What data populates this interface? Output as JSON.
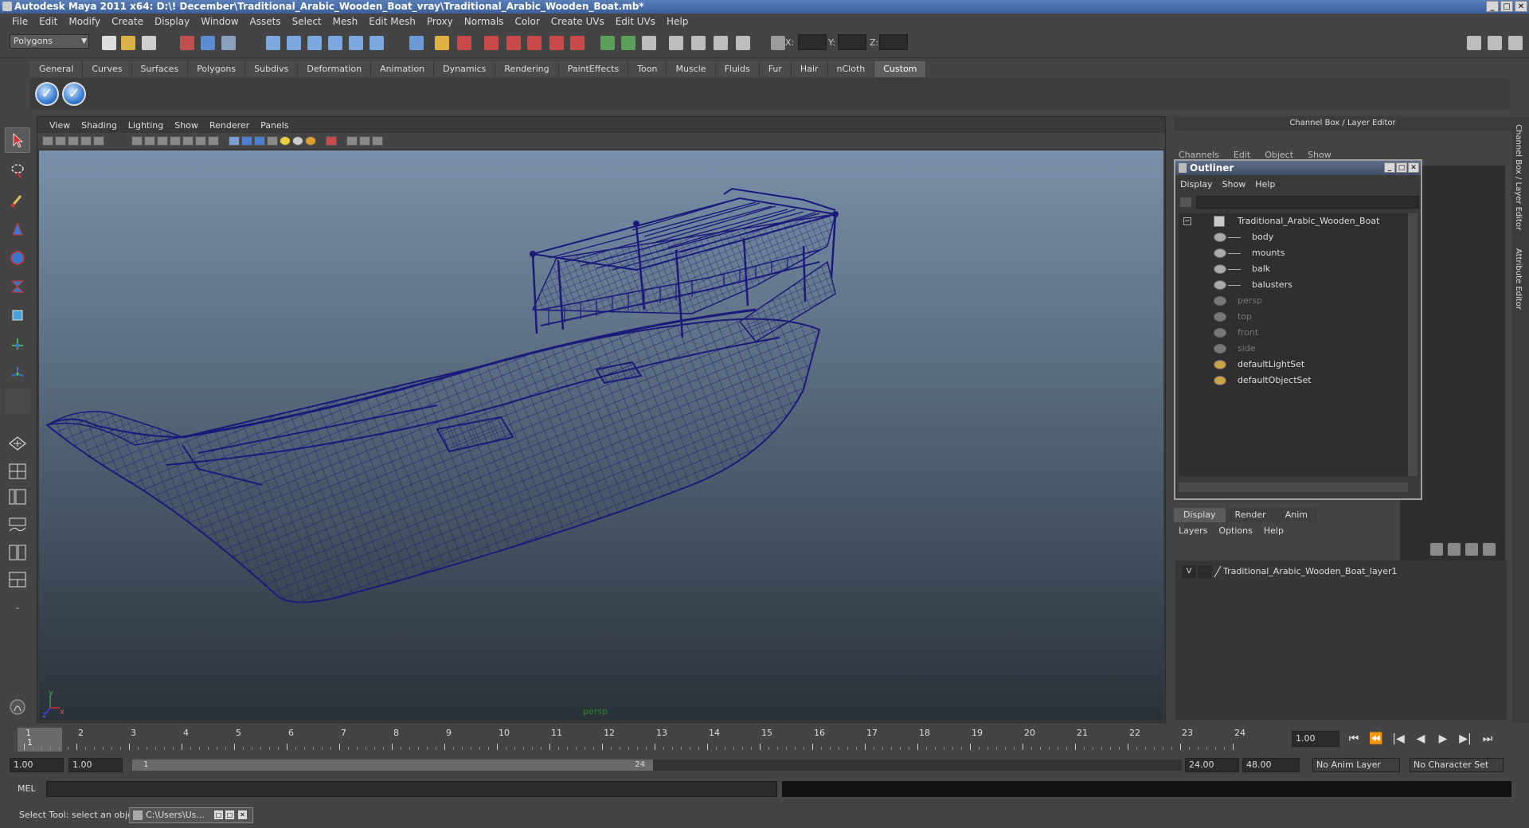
{
  "window": {
    "title": "Autodesk Maya 2011 x64: D:\\! December\\Traditional_Arabic_Wooden_Boat_vray\\Traditional_Arabic_Wooden_Boat.mb*",
    "minimize": "_",
    "maximize": "□",
    "close": "✕"
  },
  "menubar": [
    "File",
    "Edit",
    "Modify",
    "Create",
    "Display",
    "Window",
    "Assets",
    "Select",
    "Mesh",
    "Edit Mesh",
    "Proxy",
    "Normals",
    "Color",
    "Create UVs",
    "Edit UVs",
    "Help"
  ],
  "statusline": {
    "mode": "Polygons",
    "x_label": "X:",
    "y_label": "Y:",
    "z_label": "Z:"
  },
  "shelf": {
    "tabs": [
      "General",
      "Curves",
      "Surfaces",
      "Polygons",
      "Subdivs",
      "Deformation",
      "Animation",
      "Dynamics",
      "Rendering",
      "PaintEffects",
      "Toon",
      "Muscle",
      "Fluids",
      "Fur",
      "Hair",
      "nCloth",
      "Custom"
    ],
    "active_tab": "Custom",
    "buttons": [
      "check-icon",
      "check-icon"
    ],
    "button_glyph": "✓"
  },
  "viewport": {
    "menu": [
      "View",
      "Shading",
      "Lighting",
      "Show",
      "Renderer",
      "Panels"
    ],
    "camera": "persp",
    "axis_y": "y",
    "axis_x": "x",
    "axis_z": "z",
    "wire_color": "#1a1a7a"
  },
  "channel_box": {
    "header": "Channel Box / Layer Editor",
    "menu": [
      "Channels",
      "Edit",
      "Object",
      "Show"
    ]
  },
  "outliner": {
    "title": "Outliner",
    "menu": [
      "Display",
      "Show",
      "Help"
    ],
    "root": "Traditional_Arabic_Wooden_Boat",
    "children": [
      "body",
      "mounts",
      "balk",
      "balusters"
    ],
    "cameras": [
      "persp",
      "top",
      "front",
      "side"
    ],
    "sets": [
      "defaultLightSet",
      "defaultObjectSet"
    ]
  },
  "layer_editor": {
    "tabs": [
      "Display",
      "Render",
      "Anim"
    ],
    "active_tab": "Display",
    "menu": [
      "Layers",
      "Options",
      "Help"
    ],
    "layer": {
      "visible": "V",
      "name": "Traditional_Arabic_Wooden_Boat_layer1"
    }
  },
  "side_tabs": [
    "Channel Box / Layer Editor",
    "Attribute Editor"
  ],
  "timeslider": {
    "ticks": [
      "1",
      "2",
      "3",
      "4",
      "5",
      "6",
      "7",
      "8",
      "9",
      "10",
      "11",
      "12",
      "13",
      "14",
      "15",
      "16",
      "17",
      "18",
      "19",
      "20",
      "21",
      "22",
      "23",
      "24"
    ],
    "current_frame": "1",
    "current_frame_field": "1.00",
    "playback": [
      "⏮",
      "⏪",
      "|◀",
      "◀",
      "▶",
      "▶|",
      "⏭"
    ]
  },
  "range": {
    "start": "1.00",
    "playback_start": "1.00",
    "thumb_start": "1",
    "thumb_end": "24",
    "playback_end": "24.00",
    "end": "48.00",
    "anim_layer": "No Anim Layer",
    "character_set": "No Character Set"
  },
  "command_line": {
    "label": "MEL"
  },
  "help_line": {
    "text": "Select Tool: select an object",
    "task": "C:\\Users\\Us..."
  }
}
